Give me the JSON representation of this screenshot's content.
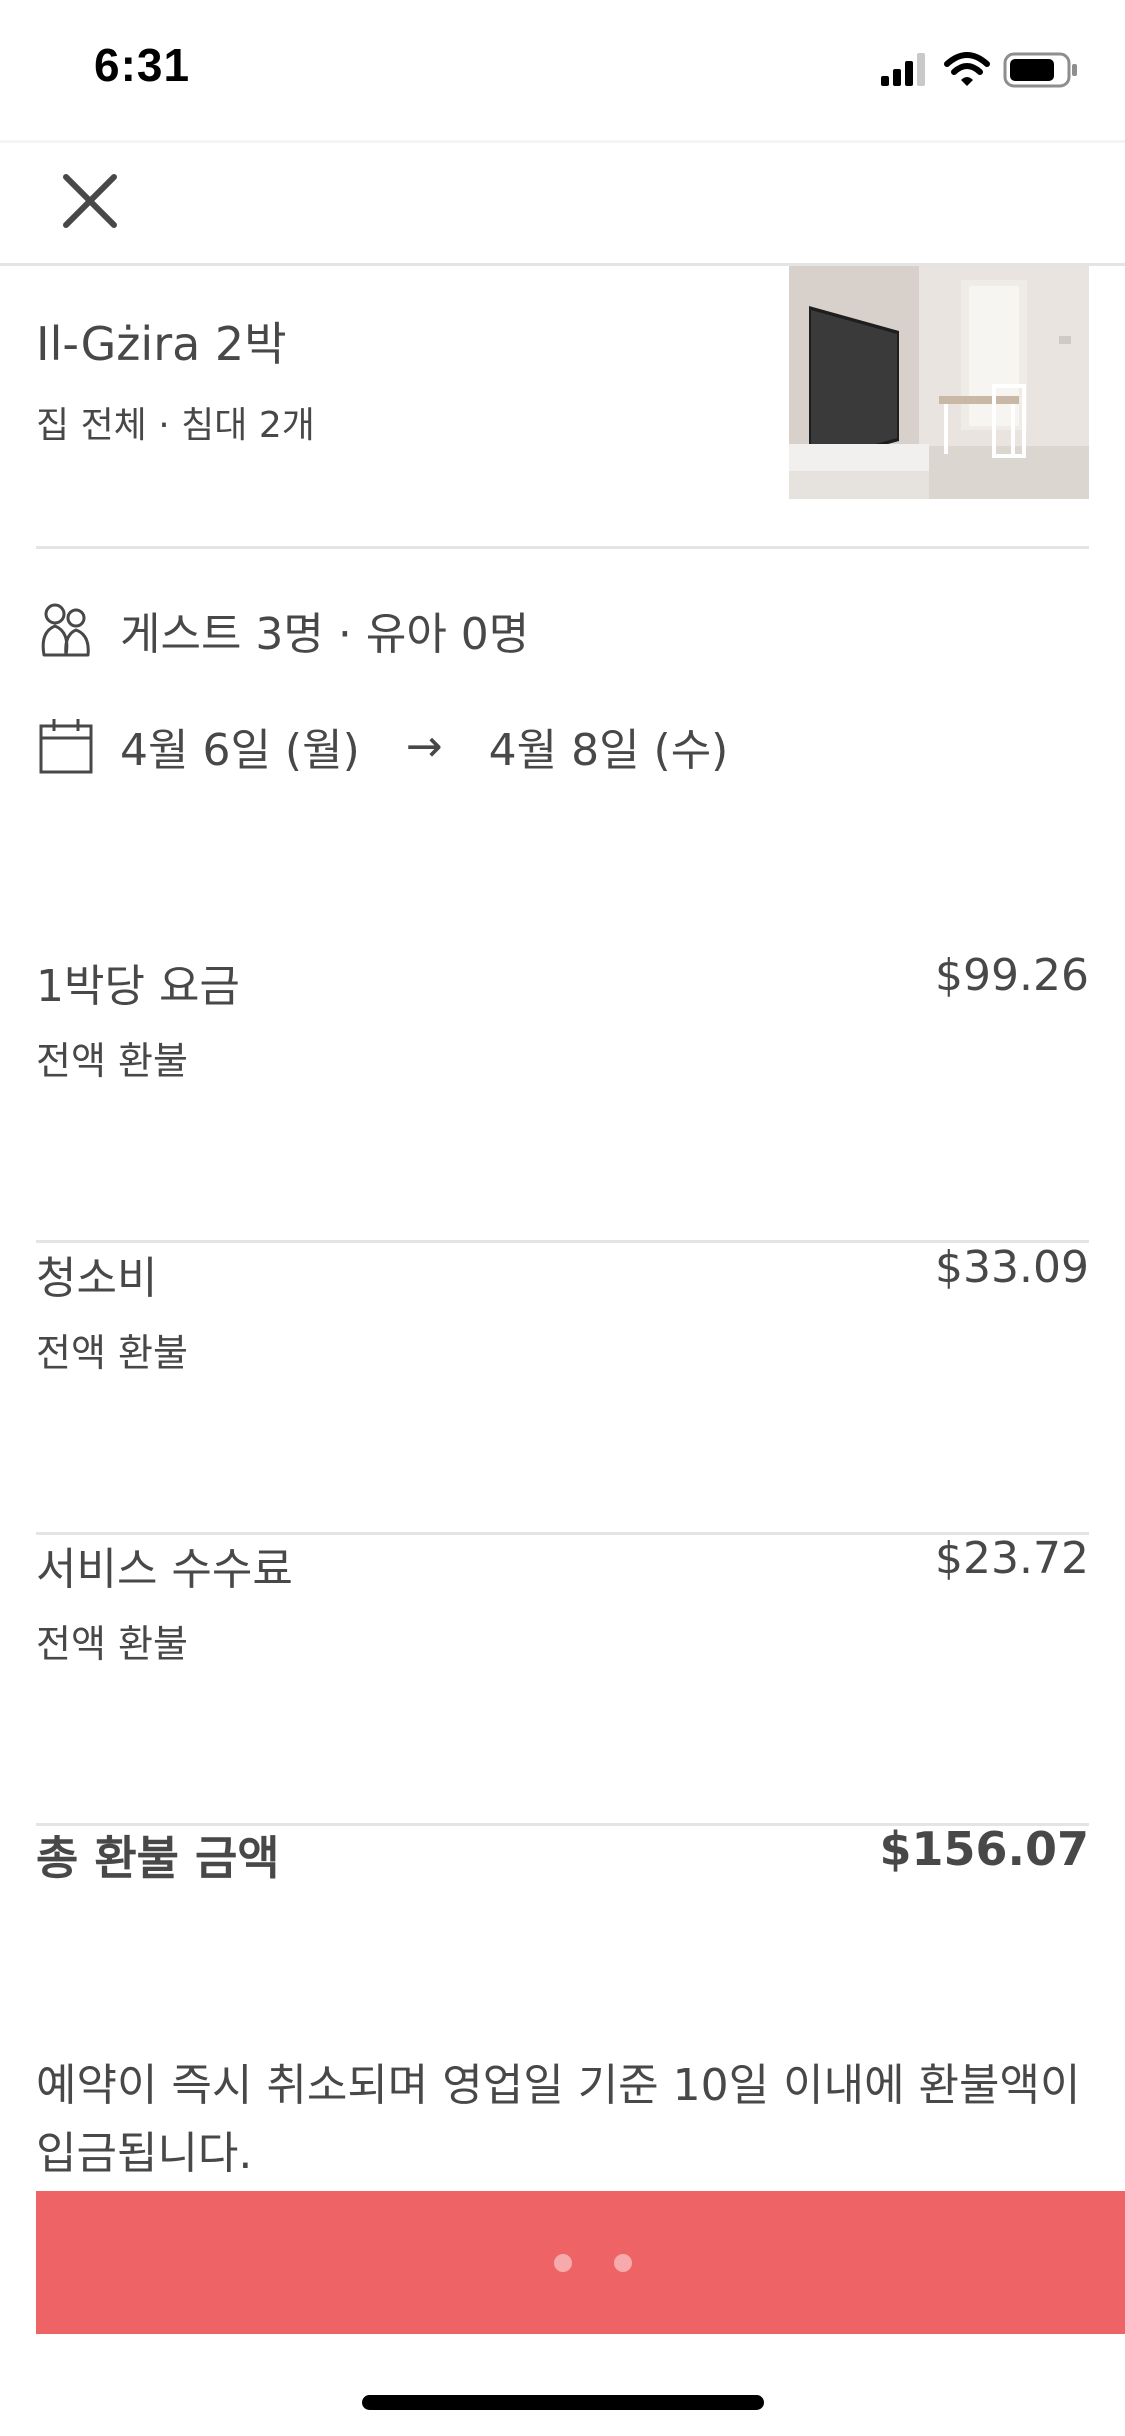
{
  "status_bar": {
    "time": "6:31"
  },
  "header": {
    "close_icon": "close-icon"
  },
  "listing": {
    "title": "Il-Gżira 2박",
    "subtitle": "집 전체 · 침대 2개",
    "photo_icon": "listing-photo"
  },
  "trip": {
    "guests_icon": "guests-icon",
    "guests": "게스트 3명 · 유아 0명",
    "calendar_icon": "calendar-icon",
    "check_in": "4월 6일 (월)",
    "arrow": "→",
    "check_out": "4월 8일 (수)"
  },
  "prices": [
    {
      "label": "1박당 요금",
      "sub": "전액 환불",
      "value": "$99.26"
    },
    {
      "label": "청소비",
      "sub": "전액 환불",
      "value": "$33.09"
    },
    {
      "label": "서비스 수수료",
      "sub": "전액 환불",
      "value": "$23.72"
    }
  ],
  "total": {
    "label": "총 환불 금액",
    "value": "$156.07"
  },
  "notice": "예약이 즉시 취소되며 영업일 기준 10일 이내에 환불액이 입금됩니다.",
  "confirm_button": {
    "state": "loading"
  },
  "colors": {
    "accent": "#ee6466",
    "text": "#484848",
    "divider": "#e4e4e4"
  }
}
